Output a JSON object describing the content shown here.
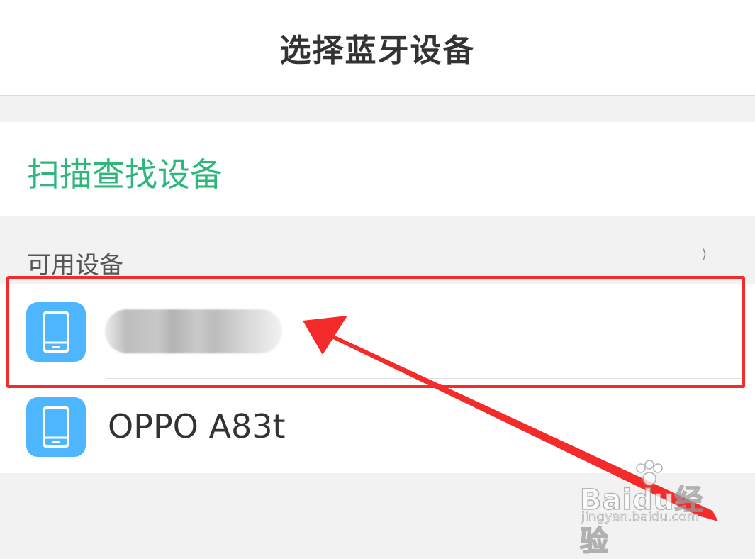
{
  "header": {
    "title": "选择蓝牙设备"
  },
  "scan": {
    "label": "扫描查找设备"
  },
  "available": {
    "label": "可用设备",
    "glyph": "⟩"
  },
  "devices": [
    {
      "name": "",
      "icon": "phone-icon",
      "blurred": true
    },
    {
      "name": "OPPO A83t",
      "icon": "phone-icon",
      "blurred": false
    }
  ],
  "watermark": {
    "logo": "Baidu经验",
    "url": "jingyan.baidu.com"
  },
  "colors": {
    "accent_green": "#2db77b",
    "icon_blue": "#4db6ff",
    "annotation_red": "#f32b2b"
  }
}
